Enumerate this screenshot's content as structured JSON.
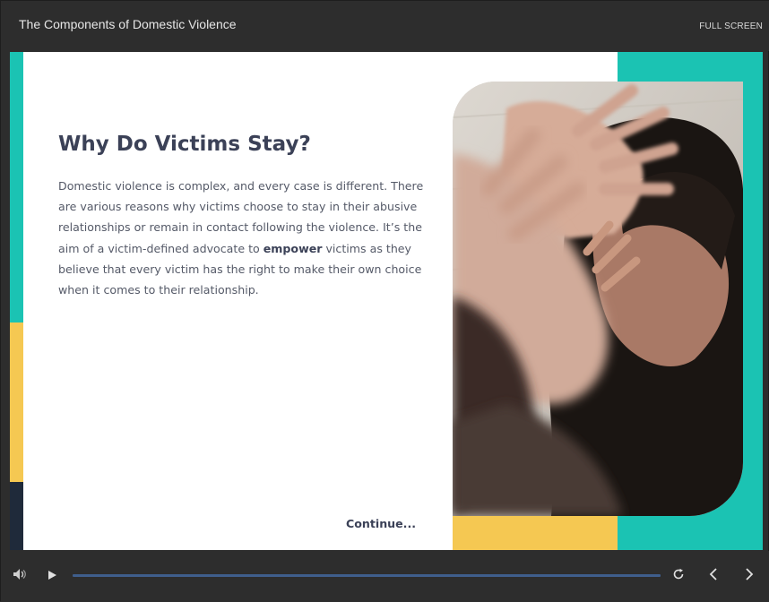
{
  "topbar": {
    "course_title": "The Components of Domestic Violence",
    "fullscreen_label": "FULL SCREEN"
  },
  "slide": {
    "title": "Why Do Victims Stay?",
    "paragraph_before": "Domestic violence is complex, and every case is different. There are various reasons why victims choose to stay in their abusive relationships or remain in contact following the violence. It’s the aim of a victim-defined advocate to ",
    "paragraph_bold": "empower",
    "paragraph_after": " victims as they believe that every victim has the right to make their own choice when it comes to their relationship.",
    "continue_label": "Continue..."
  },
  "controls": {
    "volume_icon": "volume-icon",
    "play_icon": "play-icon",
    "replay_icon": "replay-icon",
    "prev_icon": "chevron-left-icon",
    "next_icon": "chevron-right-icon",
    "progress": 1.0
  },
  "colors": {
    "teal": "#1bc3b3",
    "yellow": "#f5c852",
    "navy": "#1f2a3a",
    "title_text": "#3b4157",
    "body_text": "#555a68",
    "player_bg": "#2d2d2d",
    "progress": "#3f5e8c"
  }
}
